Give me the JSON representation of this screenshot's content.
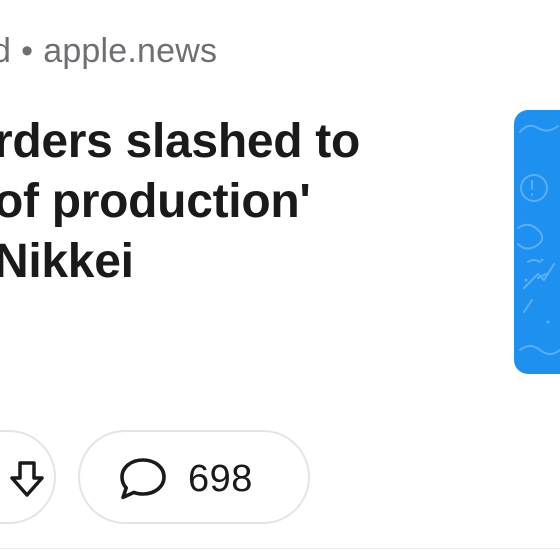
{
  "post": {
    "meta_prefix": "d",
    "meta_separator": "•",
    "domain": "apple.news",
    "headline_lines": [
      "rders slashed to",
      "of production'",
      "Nikkei"
    ],
    "thumbnail_icon": "article-thumbnail",
    "thumbnail_color": "#1e90f0"
  },
  "actions": {
    "vote_icon": "downvote-arrow-icon",
    "comments_icon": "comment-bubble-icon",
    "comment_count": "698"
  }
}
